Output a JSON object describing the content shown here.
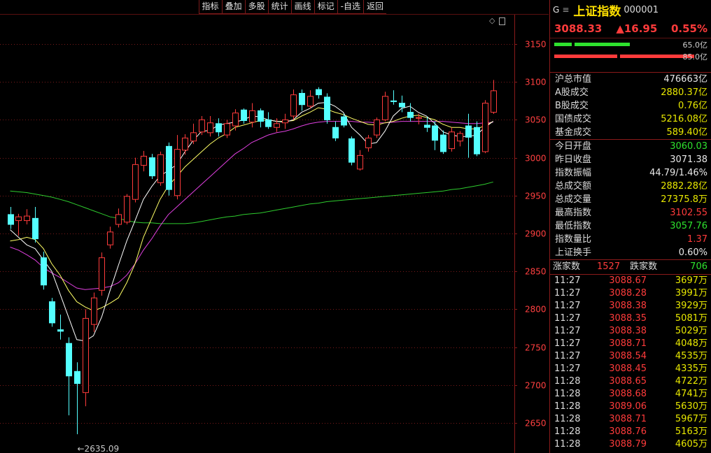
{
  "toolbar": [
    "指标",
    "叠加",
    "多股",
    "统计",
    "画线",
    "标记",
    "-自选",
    "返回"
  ],
  "chart_data": {
    "type": "candlestick",
    "ylim": [
      2600,
      3180
    ],
    "yticks": [
      2650,
      2700,
      2750,
      2800,
      2850,
      2900,
      2950,
      3000,
      3050,
      3100,
      3150
    ],
    "annotation": "←2635.09",
    "colors": {
      "up": "#ff3b3b",
      "down": "#54ffff",
      "ma_white": "#ffffff",
      "ma_yellow": "#ffff66",
      "ma_magenta": "#e040e0",
      "ma_green": "#2ecc2e",
      "grid": "#7a1a1a"
    },
    "candles": [
      [
        2925,
        2912,
        2935,
        2906
      ],
      [
        2917,
        2922,
        2926,
        2897
      ],
      [
        2917,
        2923,
        2932,
        2912
      ],
      [
        2920,
        2893,
        2935,
        2888
      ],
      [
        2868,
        2832,
        2876,
        2826
      ],
      [
        2810,
        2782,
        2815,
        2777
      ],
      [
        2773,
        2771,
        2793,
        2760
      ],
      [
        2755,
        2712,
        2763,
        2660
      ],
      [
        2718,
        2702,
        2730,
        2635.09
      ],
      [
        2690,
        2788,
        2800,
        2672
      ],
      [
        2780,
        2815,
        2822,
        2770
      ],
      [
        2825,
        2868,
        2875,
        2818
      ],
      [
        2885,
        2902,
        2909,
        2880
      ],
      [
        2912,
        2925,
        2933,
        2908
      ],
      [
        2915,
        2949,
        2952,
        2912
      ],
      [
        2945,
        2991,
        3000,
        2941
      ],
      [
        2990,
        3002,
        3009,
        2982
      ],
      [
        3000,
        2976,
        3005,
        2972
      ],
      [
        2967,
        3004,
        3008,
        2963
      ],
      [
        3015,
        2958,
        3020,
        2950
      ],
      [
        2950,
        3011,
        3030,
        2945
      ],
      [
        3010,
        3026,
        3031,
        3004
      ],
      [
        3022,
        3033,
        3045,
        3018
      ],
      [
        3034,
        3050,
        3055,
        3030
      ],
      [
        3033,
        3046,
        3055,
        3028
      ],
      [
        3045,
        3034,
        3052,
        3028
      ],
      [
        3030,
        3045,
        3050,
        3026
      ],
      [
        3042,
        3059,
        3064,
        3036
      ],
      [
        3063,
        3049,
        3065,
        3045
      ],
      [
        3047,
        3062,
        3072,
        3040
      ],
      [
        3062,
        3048,
        3065,
        3040
      ],
      [
        3050,
        3041,
        3060,
        3038
      ],
      [
        3040,
        3045,
        3052,
        3034
      ],
      [
        3046,
        3050,
        3058,
        3038
      ],
      [
        3055,
        3083,
        3090,
        3050
      ],
      [
        3085,
        3070,
        3090,
        3062
      ],
      [
        3068,
        3081,
        3089,
        3065
      ],
      [
        3090,
        3083,
        3093,
        3078
      ],
      [
        3080,
        3050,
        3085,
        3045
      ],
      [
        3040,
        3026,
        3048,
        3022
      ],
      [
        3054,
        3043,
        3058,
        3040
      ],
      [
        3025,
        2994,
        3028,
        2990
      ],
      [
        2985,
        3003,
        3010,
        2983
      ],
      [
        3013,
        3026,
        3030,
        3008
      ],
      [
        3030,
        3050,
        3053,
        3026
      ],
      [
        3050,
        3081,
        3087,
        3048
      ],
      [
        3075,
        3074,
        3089,
        3070
      ],
      [
        3072,
        3067,
        3082,
        3060
      ],
      [
        3060,
        3053,
        3072,
        3048
      ],
      [
        3052,
        3053,
        3058,
        3044
      ],
      [
        3043,
        3040,
        3054,
        3034
      ],
      [
        3042,
        3023,
        3048,
        3010
      ],
      [
        3030,
        3008,
        3036,
        3005
      ],
      [
        3012,
        3034,
        3040,
        3008
      ],
      [
        3022,
        3032,
        3035,
        3015
      ],
      [
        3042,
        3027,
        3058,
        3000
      ],
      [
        3040,
        3005,
        3048,
        3002
      ],
      [
        3008,
        3072,
        3076,
        3006
      ],
      [
        3060,
        3088.33,
        3102.55,
        3057.76
      ]
    ],
    "ma_white": [
      2905,
      2895,
      2885,
      2880,
      2865,
      2850,
      2820,
      2790,
      2760,
      2758,
      2765,
      2790,
      2825,
      2858,
      2890,
      2917,
      2945,
      2962,
      2976,
      2983,
      2991,
      3008,
      3023,
      3035,
      3036,
      3043,
      3045,
      3047,
      3050,
      3055,
      3054,
      3050,
      3048,
      3047,
      3050,
      3060,
      3065,
      3072,
      3073,
      3068,
      3060,
      3040,
      3030,
      3018,
      3020,
      3035,
      3055,
      3065,
      3068,
      3060,
      3055,
      3045,
      3034,
      3030,
      3028,
      3028,
      3030,
      3040,
      3048
    ],
    "ma_yellow": [
      2890,
      2892,
      2895,
      2892,
      2880,
      2860,
      2845,
      2825,
      2810,
      2803,
      2798,
      2802,
      2808,
      2815,
      2835,
      2860,
      2895,
      2920,
      2945,
      2963,
      2975,
      2988,
      2998,
      3008,
      3018,
      3026,
      3032,
      3040,
      3043,
      3046,
      3049,
      3050,
      3048,
      3048,
      3049,
      3055,
      3060,
      3066,
      3064,
      3060,
      3057,
      3052,
      3048,
      3044,
      3043,
      3046,
      3048,
      3052,
      3055,
      3056,
      3053,
      3050,
      3044,
      3040,
      3040,
      3038,
      3038,
      3042,
      3048
    ],
    "ma_magenta": [
      2882,
      2878,
      2872,
      2865,
      2855,
      2848,
      2842,
      2835,
      2828,
      2826,
      2827,
      2828,
      2830,
      2835,
      2845,
      2860,
      2878,
      2893,
      2910,
      2925,
      2935,
      2945,
      2955,
      2965,
      2975,
      2985,
      2995,
      3005,
      3012,
      3020,
      3025,
      3030,
      3033,
      3035,
      3038,
      3042,
      3045,
      3047,
      3048,
      3048,
      3048,
      3048,
      3047,
      3047,
      3046,
      3046,
      3047,
      3048,
      3048,
      3048,
      3048,
      3048,
      3048,
      3047,
      3046,
      3045,
      3045,
      3046,
      3047
    ],
    "ma_green": [
      2956,
      2955,
      2954,
      2952,
      2950,
      2948,
      2945,
      2942,
      2938,
      2934,
      2930,
      2926,
      2922,
      2920,
      2917,
      2915,
      2914,
      2914,
      2913,
      2913,
      2913,
      2913,
      2914,
      2916,
      2918,
      2920,
      2922,
      2923,
      2925,
      2926,
      2927,
      2929,
      2931,
      2933,
      2935,
      2937,
      2939,
      2940,
      2942,
      2943,
      2944,
      2945,
      2946,
      2947,
      2948,
      2949,
      2950,
      2951,
      2952,
      2953,
      2954,
      2955,
      2956,
      2958,
      2959,
      2961,
      2963,
      2965,
      2968
    ]
  },
  "panel": {
    "brand": "G",
    "menu_icon": "≡",
    "name": "上证指数",
    "code": "000001",
    "price": "3088.33",
    "change": "▲16.95",
    "pct": "0.55%",
    "bar_green_val": "65.0亿",
    "bar_red_val": "85.0亿",
    "market": [
      {
        "k": "沪总市值",
        "v": "476663亿",
        "c": "white"
      },
      {
        "k": "A股成交",
        "v": "2880.37亿",
        "c": "yellow"
      },
      {
        "k": "B股成交",
        "v": "0.76亿",
        "c": "yellow"
      },
      {
        "k": "国债成交",
        "v": "5216.08亿",
        "c": "yellow"
      },
      {
        "k": "基金成交",
        "v": "589.40亿",
        "c": "yellow"
      }
    ],
    "stats": [
      {
        "k": "今日开盘",
        "v": "3060.03",
        "c": "green"
      },
      {
        "k": "昨日收盘",
        "v": "3071.38",
        "c": "white"
      },
      {
        "k": "指数振幅",
        "v": "44.79/1.46%",
        "c": "white"
      },
      {
        "k": "总成交额",
        "v": "2882.28亿",
        "c": "yellow"
      },
      {
        "k": "总成交量",
        "v": "27375.8万",
        "c": "yellow"
      },
      {
        "k": "最高指数",
        "v": "3102.55",
        "c": "red"
      },
      {
        "k": "最低指数",
        "v": "3057.76",
        "c": "green"
      },
      {
        "k": "指数量比",
        "v": "1.37",
        "c": "red"
      },
      {
        "k": "上证换手",
        "v": "0.60%",
        "c": "white"
      }
    ],
    "up_label": "涨家数",
    "up_count": "1527",
    "down_label": "跌家数",
    "down_count": "706",
    "ticks": [
      {
        "t": "11:27",
        "p": "3088.67",
        "v": "3697万"
      },
      {
        "t": "11:27",
        "p": "3088.28",
        "v": "3991万"
      },
      {
        "t": "11:27",
        "p": "3088.38",
        "v": "3929万"
      },
      {
        "t": "11:27",
        "p": "3088.35",
        "v": "5081万"
      },
      {
        "t": "11:27",
        "p": "3088.38",
        "v": "5029万"
      },
      {
        "t": "11:27",
        "p": "3088.71",
        "v": "4048万"
      },
      {
        "t": "11:27",
        "p": "3088.54",
        "v": "4535万"
      },
      {
        "t": "11:27",
        "p": "3088.45",
        "v": "4335万"
      },
      {
        "t": "11:28",
        "p": "3088.65",
        "v": "4722万"
      },
      {
        "t": "11:28",
        "p": "3088.68",
        "v": "4741万"
      },
      {
        "t": "11:28",
        "p": "3089.06",
        "v": "5630万"
      },
      {
        "t": "11:28",
        "p": "3088.71",
        "v": "5967万"
      },
      {
        "t": "11:28",
        "p": "3088.76",
        "v": "5163万"
      },
      {
        "t": "11:28",
        "p": "3088.79",
        "v": "4605万"
      }
    ]
  }
}
